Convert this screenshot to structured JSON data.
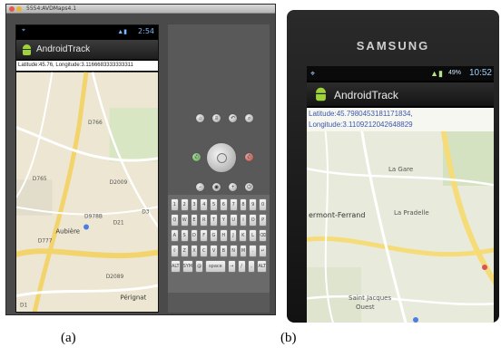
{
  "panel_a": {
    "window_title": "5554:AVDMaps4.1",
    "clock": "2:54",
    "app_title": "AndroidTrack",
    "coords_text": "Latitude:45.76, Longitude:3.1166683333333311",
    "map_labels": {
      "d766": "D766",
      "d2009": "D2009",
      "d765": "D765",
      "d21": "D21",
      "d978b": "D978B",
      "aubiere": "Aubière",
      "d777": "D777",
      "d2089": "D2089",
      "d3": "D3",
      "pergnat": "Pérignat",
      "d1": "D1"
    },
    "keyboard_rows": [
      [
        "1",
        "2",
        "3",
        "4",
        "5",
        "6",
        "7",
        "8",
        "9",
        "0"
      ],
      [
        "Q",
        "W",
        "E",
        "R",
        "T",
        "Y",
        "U",
        "I",
        "O",
        "P"
      ],
      [
        "A",
        "S",
        "D",
        "F",
        "G",
        "H",
        "J",
        "K",
        "L",
        "⌫"
      ],
      [
        "⇧",
        "Z",
        "X",
        "C",
        "V",
        "B",
        "N",
        "M",
        ".",
        "↵"
      ],
      [
        "ALT",
        "SYM",
        "@",
        "space",
        "→",
        "/",
        ",",
        "ALT"
      ]
    ],
    "colors": {
      "map_bg": "#ece6d2",
      "road": "#f3d36b",
      "road_minor": "#ffffff"
    }
  },
  "panel_b": {
    "brand": "SAMSUNG",
    "clock": "10:52",
    "battery": "49%",
    "app_title": "AndroidTrack",
    "latitude_line": "Latitude:45.7980453181171834,",
    "longitude_line": "Longitude:3.1109212042648829",
    "map_labels": {
      "la_gare": "La Gare",
      "clermont_ferrand": "ermont-Ferrand",
      "la_pradelle": "La Pradelle",
      "saint_jacques": "Saint Jacques",
      "ouest": "Ouest"
    },
    "colors": {
      "map_bg": "#e8eadb",
      "road": "#f5dc79",
      "accent": "#3b57a8"
    }
  },
  "captions": {
    "a": "(a)",
    "b": "(b)"
  }
}
